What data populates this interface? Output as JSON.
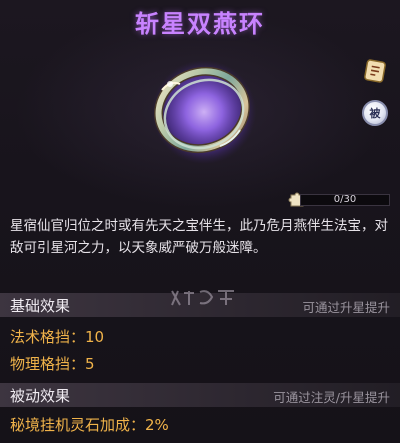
{
  "item": {
    "name": "斩星双燕环",
    "description": "星宿仙官归位之时或有先天之宝伴生，此乃危月燕伴生法宝，对敌可引星河之力，以天象威严破万般迷障。"
  },
  "side_badges": {
    "upgrade_icon": "upgrade-scroll-icon",
    "passive_label": "被"
  },
  "fragments": {
    "label": "0/30",
    "current": 0,
    "total": 30,
    "icon": "puzzle-piece-icon"
  },
  "basic_effects": {
    "title": "基础效果",
    "hint": "可通过升星提升",
    "stats": [
      "法术格挡：10",
      "物理格挡：5"
    ]
  },
  "passive_effects": {
    "title": "被动效果",
    "hint": "可通过注灵/升星提升",
    "stats": [
      "秘境挂机灵石加成：2%"
    ]
  },
  "colors": {
    "title": "#c883ff",
    "stat": "#f0b34a",
    "ring_glow": "#a070ff"
  }
}
